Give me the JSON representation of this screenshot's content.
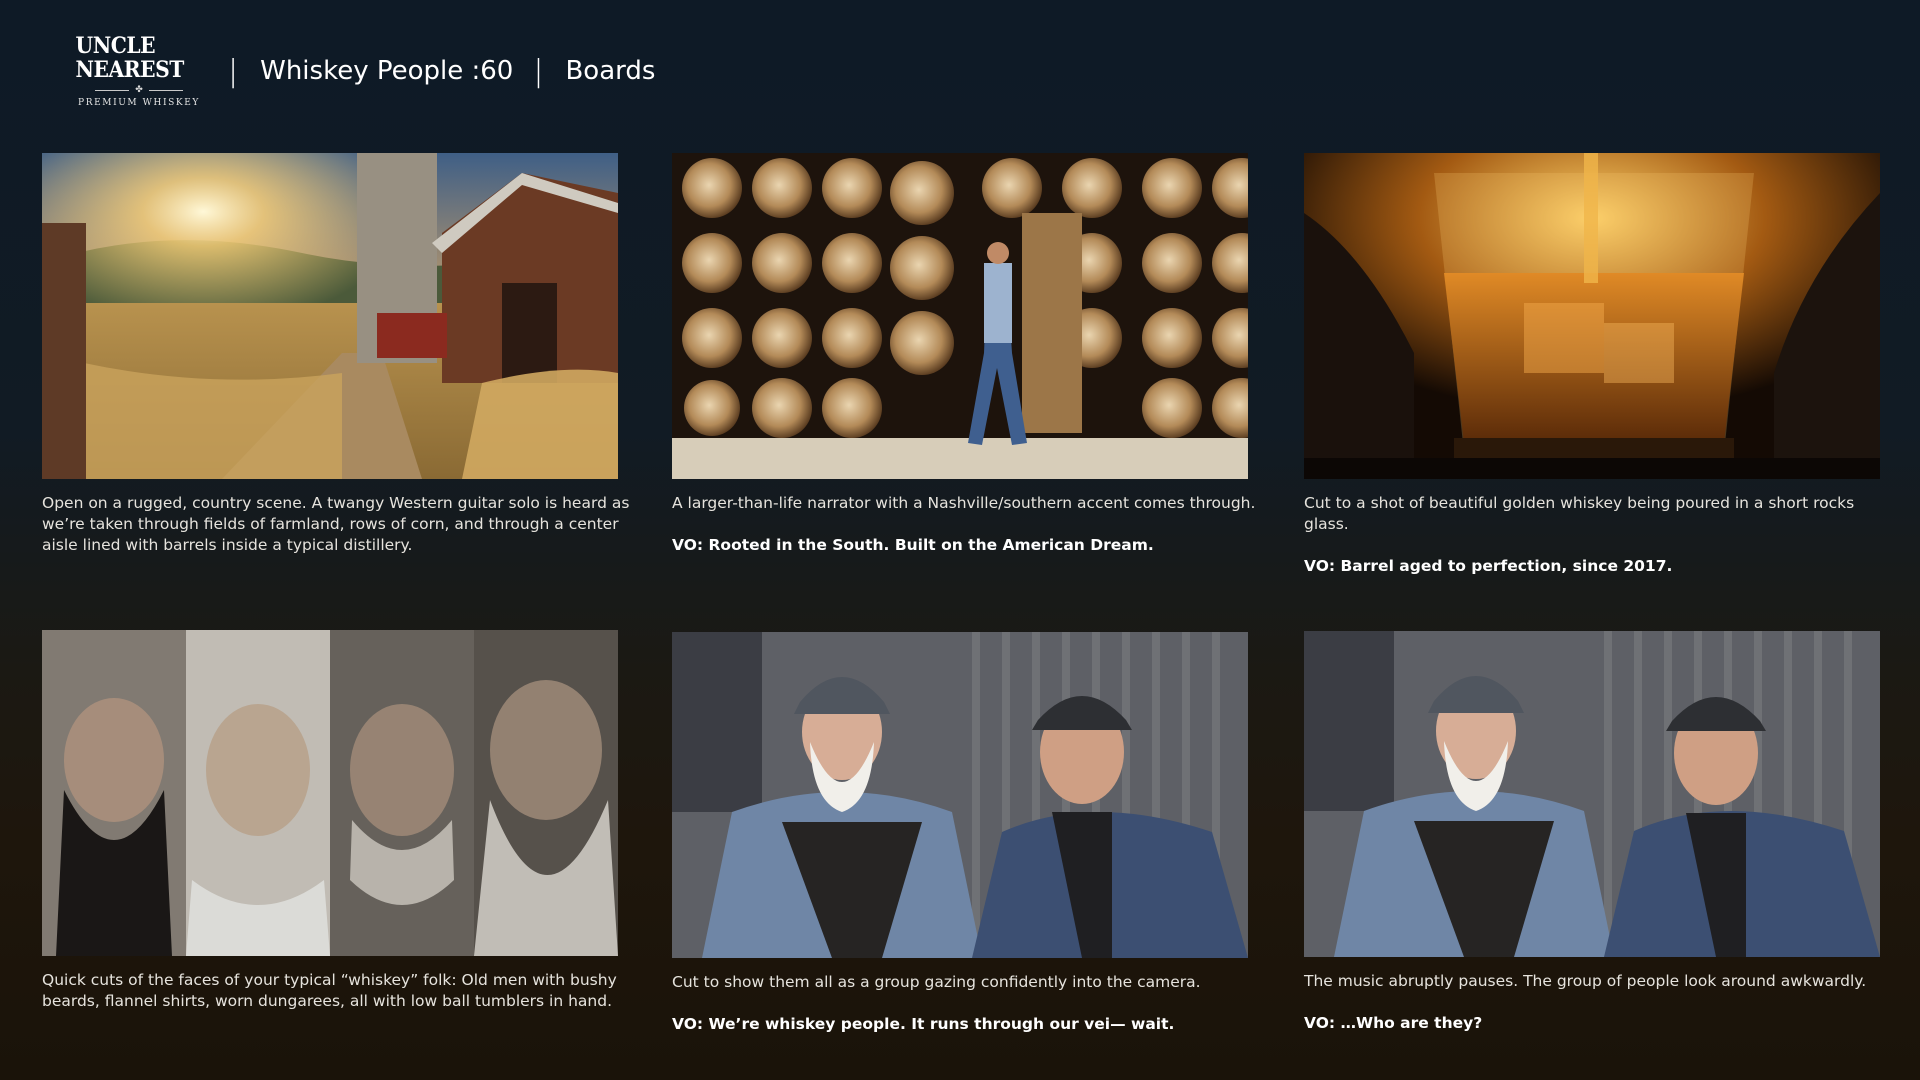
{
  "header": {
    "logo_word": "UNCLE NEAREST",
    "logo_sub": "PREMIUM WHISKEY",
    "separator": "|",
    "project": "Whiskey People :60",
    "section": "Boards"
  },
  "colors": {
    "background": "#111b24",
    "text": "#e6e3dd",
    "vo_text": "#ffffff"
  },
  "panels": [
    {
      "image": "farm-scene-sunset-barn-silo",
      "description": "Open on a rugged, country scene. A twangy Western guitar solo is heard as we’re taken through fields of farmland, rows of corn, and through a center aisle lined with barrels inside a typical distillery.",
      "vo": ""
    },
    {
      "image": "man-walking-past-barrel-racks",
      "description": "A larger-than-life narrator with a Nashville/southern accent comes through.",
      "vo": "VO: Rooted in the South. Built on the American Dream."
    },
    {
      "image": "golden-whiskey-in-rocks-glass",
      "description": "Cut to a shot of beautiful golden whiskey being poured in a short rocks glass.",
      "vo": "VO: Barrel aged to perfection, since 2017."
    },
    {
      "image": "four-bearded-faces-collage",
      "description": "Quick cuts of the faces of your typical “whiskey” folk: Old men with bushy beards, flannel shirts, worn dungarees, all with low ball tumblers in hand.",
      "vo": ""
    },
    {
      "image": "two-men-smiling-at-camera",
      "description": "Cut to show them all as a group gazing confidently into the camera.",
      "vo": "VO: We’re whiskey people. It runs through our vei— wait."
    },
    {
      "image": "two-men-looking-around",
      "description": "The music abruptly pauses. The group of people look around awkwardly.",
      "vo": "VO: …Who are they?"
    }
  ]
}
